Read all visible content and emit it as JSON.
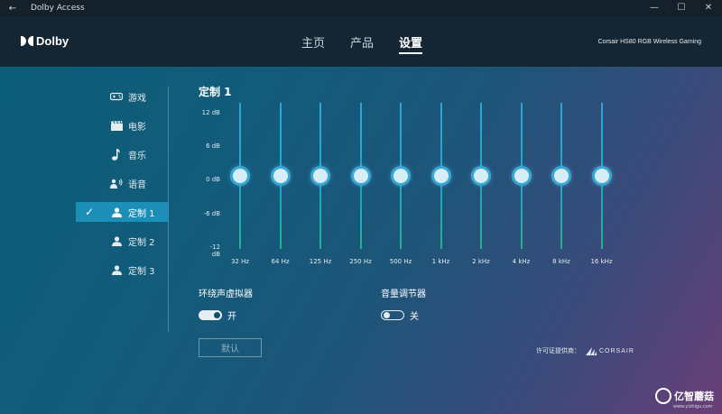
{
  "window": {
    "title": "Dolby Access",
    "back": "←",
    "minimize": "—",
    "maximize": "☐",
    "close": "✕"
  },
  "header": {
    "logo_text": "Dolby",
    "nav": [
      {
        "label": "主页"
      },
      {
        "label": "产品"
      },
      {
        "label": "设置",
        "active": true
      }
    ],
    "device": "Corsair HS80 RGB Wireless Gaming"
  },
  "sidebar": {
    "items": [
      {
        "label": "游戏",
        "icon": "gamepad-icon"
      },
      {
        "label": "电影",
        "icon": "clapperboard-icon"
      },
      {
        "label": "音乐",
        "icon": "music-note-icon"
      },
      {
        "label": "语音",
        "icon": "voice-icon"
      },
      {
        "label": "定制 1",
        "icon": "user-icon",
        "selected": true,
        "check": "✓"
      },
      {
        "label": "定制 2",
        "icon": "user-icon"
      },
      {
        "label": "定制 3",
        "icon": "user-icon"
      }
    ]
  },
  "panel": {
    "title": "定制 1",
    "db_labels": [
      "12 dB",
      "6 dB",
      "0 dB",
      "-6 dB",
      "-12 dB"
    ],
    "bands": [
      {
        "freq": "32 Hz",
        "gain_db": 0
      },
      {
        "freq": "64 Hz",
        "gain_db": 0
      },
      {
        "freq": "125 Hz",
        "gain_db": 0
      },
      {
        "freq": "250 Hz",
        "gain_db": 0
      },
      {
        "freq": "500 Hz",
        "gain_db": 0
      },
      {
        "freq": "1 kHz",
        "gain_db": 0
      },
      {
        "freq": "2 kHz",
        "gain_db": 0
      },
      {
        "freq": "4 kHz",
        "gain_db": 0
      },
      {
        "freq": "8 kHz",
        "gain_db": 0
      },
      {
        "freq": "16 kHz",
        "gain_db": 0
      }
    ],
    "virtualizer": {
      "label": "环绕声虚拟器",
      "state": "开",
      "on": true
    },
    "volume_leveler": {
      "label": "音量调节器",
      "state": "关",
      "on": false
    },
    "default_button": "默认",
    "license_text": "许可证提供商：",
    "license_brand": "CORSAIR"
  },
  "watermark": {
    "text": "亿智蘑菇",
    "url": "www.yizhigu.com"
  },
  "colors": {
    "accent": "#1b8fb8",
    "header": "#142634",
    "track": "#2aa8d8"
  }
}
